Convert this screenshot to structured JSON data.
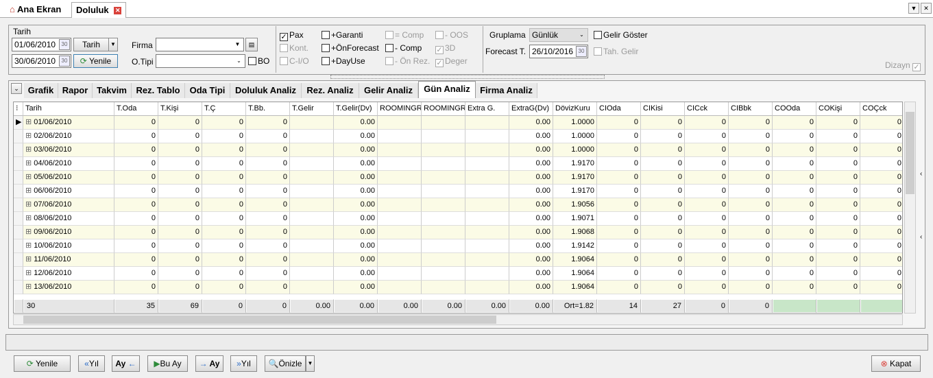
{
  "tabs": [
    {
      "label": "Ana Ekran"
    },
    {
      "label": "Doluluk"
    }
  ],
  "filters": {
    "tarih_label": "Tarih",
    "date_from": "01/06/2010",
    "date_to": "30/06/2010",
    "tarih_btn": "Tarih",
    "yenile_btn": "Yenile",
    "firma_label": "Firma",
    "firma_value": "",
    "otipi_label": "O.Tipi",
    "otipi_value": "",
    "bo_label": "BO",
    "checks": [
      {
        "label": "Pax",
        "checked": true,
        "enabled": true
      },
      {
        "label": "+Garanti",
        "checked": false,
        "enabled": true
      },
      {
        "label": "= Comp",
        "checked": false,
        "enabled": false
      },
      {
        "label": "- OOS",
        "checked": false,
        "enabled": false
      },
      {
        "label": "Kont.",
        "checked": false,
        "enabled": false
      },
      {
        "label": "+ÖnForecast",
        "checked": false,
        "enabled": true
      },
      {
        "label": "- Comp",
        "checked": false,
        "enabled": true
      },
      {
        "label": "3D",
        "checked": true,
        "enabled": false
      },
      {
        "label": "C-I/O",
        "checked": false,
        "enabled": false
      },
      {
        "label": "+DayUse",
        "checked": false,
        "enabled": true
      },
      {
        "label": "- Ön Rez.",
        "checked": false,
        "enabled": false
      },
      {
        "label": "Deger",
        "checked": true,
        "enabled": false
      }
    ],
    "gruplama_label": "Gruplama",
    "gruplama_value": "Günlük",
    "gelir_goster": "Gelir Göster",
    "forecast_label": "Forecast T.",
    "forecast_value": "26/10/2016",
    "tah_gelir": "Tah. Gelir",
    "dizayn": "Dizayn"
  },
  "inner_tabs": [
    "Grafik",
    "Rapor",
    "Takvim",
    "Rez. Tablo",
    "Oda Tipi",
    "Doluluk Analiz",
    "Rez. Analiz",
    "Gelir Analiz",
    "Gün Analiz",
    "Firma Analiz"
  ],
  "columns": [
    "Tarih",
    "T.Oda",
    "T.Kişi",
    "T.Ç",
    "T.Bb.",
    "T.Gelir",
    "T.Gelir(Dv)",
    "ROOMINGRE",
    "ROOMINGRE",
    "Extra G.",
    "ExtraG(Dv)",
    "DövizKuru",
    "CIOda",
    "CIKisi",
    "CICck",
    "CIBbk",
    "COOda",
    "COKişi",
    "COÇck"
  ],
  "rows": [
    {
      "date": "01/06/2010",
      "kur": "1.0000"
    },
    {
      "date": "02/06/2010",
      "kur": "1.0000"
    },
    {
      "date": "03/06/2010",
      "kur": "1.0000"
    },
    {
      "date": "04/06/2010",
      "kur": "1.9170"
    },
    {
      "date": "05/06/2010",
      "kur": "1.9170"
    },
    {
      "date": "06/06/2010",
      "kur": "1.9170"
    },
    {
      "date": "07/06/2010",
      "kur": "1.9056"
    },
    {
      "date": "08/06/2010",
      "kur": "1.9071"
    },
    {
      "date": "09/06/2010",
      "kur": "1.9068"
    },
    {
      "date": "10/06/2010",
      "kur": "1.9142"
    },
    {
      "date": "11/06/2010",
      "kur": "1.9064"
    },
    {
      "date": "12/06/2010",
      "kur": "1.9064"
    },
    {
      "date": "13/06/2010",
      "kur": "1.9064"
    }
  ],
  "cell_values": {
    "zero": "0",
    "money": "0.00"
  },
  "footer": [
    "30",
    "35",
    "69",
    "0",
    "0",
    "0.00",
    "0.00",
    "0.00",
    "0.00",
    "0.00",
    "0.00",
    "Ort=1.82",
    "14",
    "27",
    "0",
    "0"
  ],
  "bottom": {
    "yenile": "Yenile",
    "yil_back": "Yıl",
    "ay_back": "Ay",
    "bu_ay": "Bu Ay",
    "ay_fwd": "Ay",
    "yil_fwd": "Yıl",
    "onizle": "Önizle",
    "kapat": "Kapat"
  },
  "colors": {
    "row_alt": "#fbfbe6",
    "footer_green": "#c8e6c8",
    "accent_red": "#d9413a"
  }
}
